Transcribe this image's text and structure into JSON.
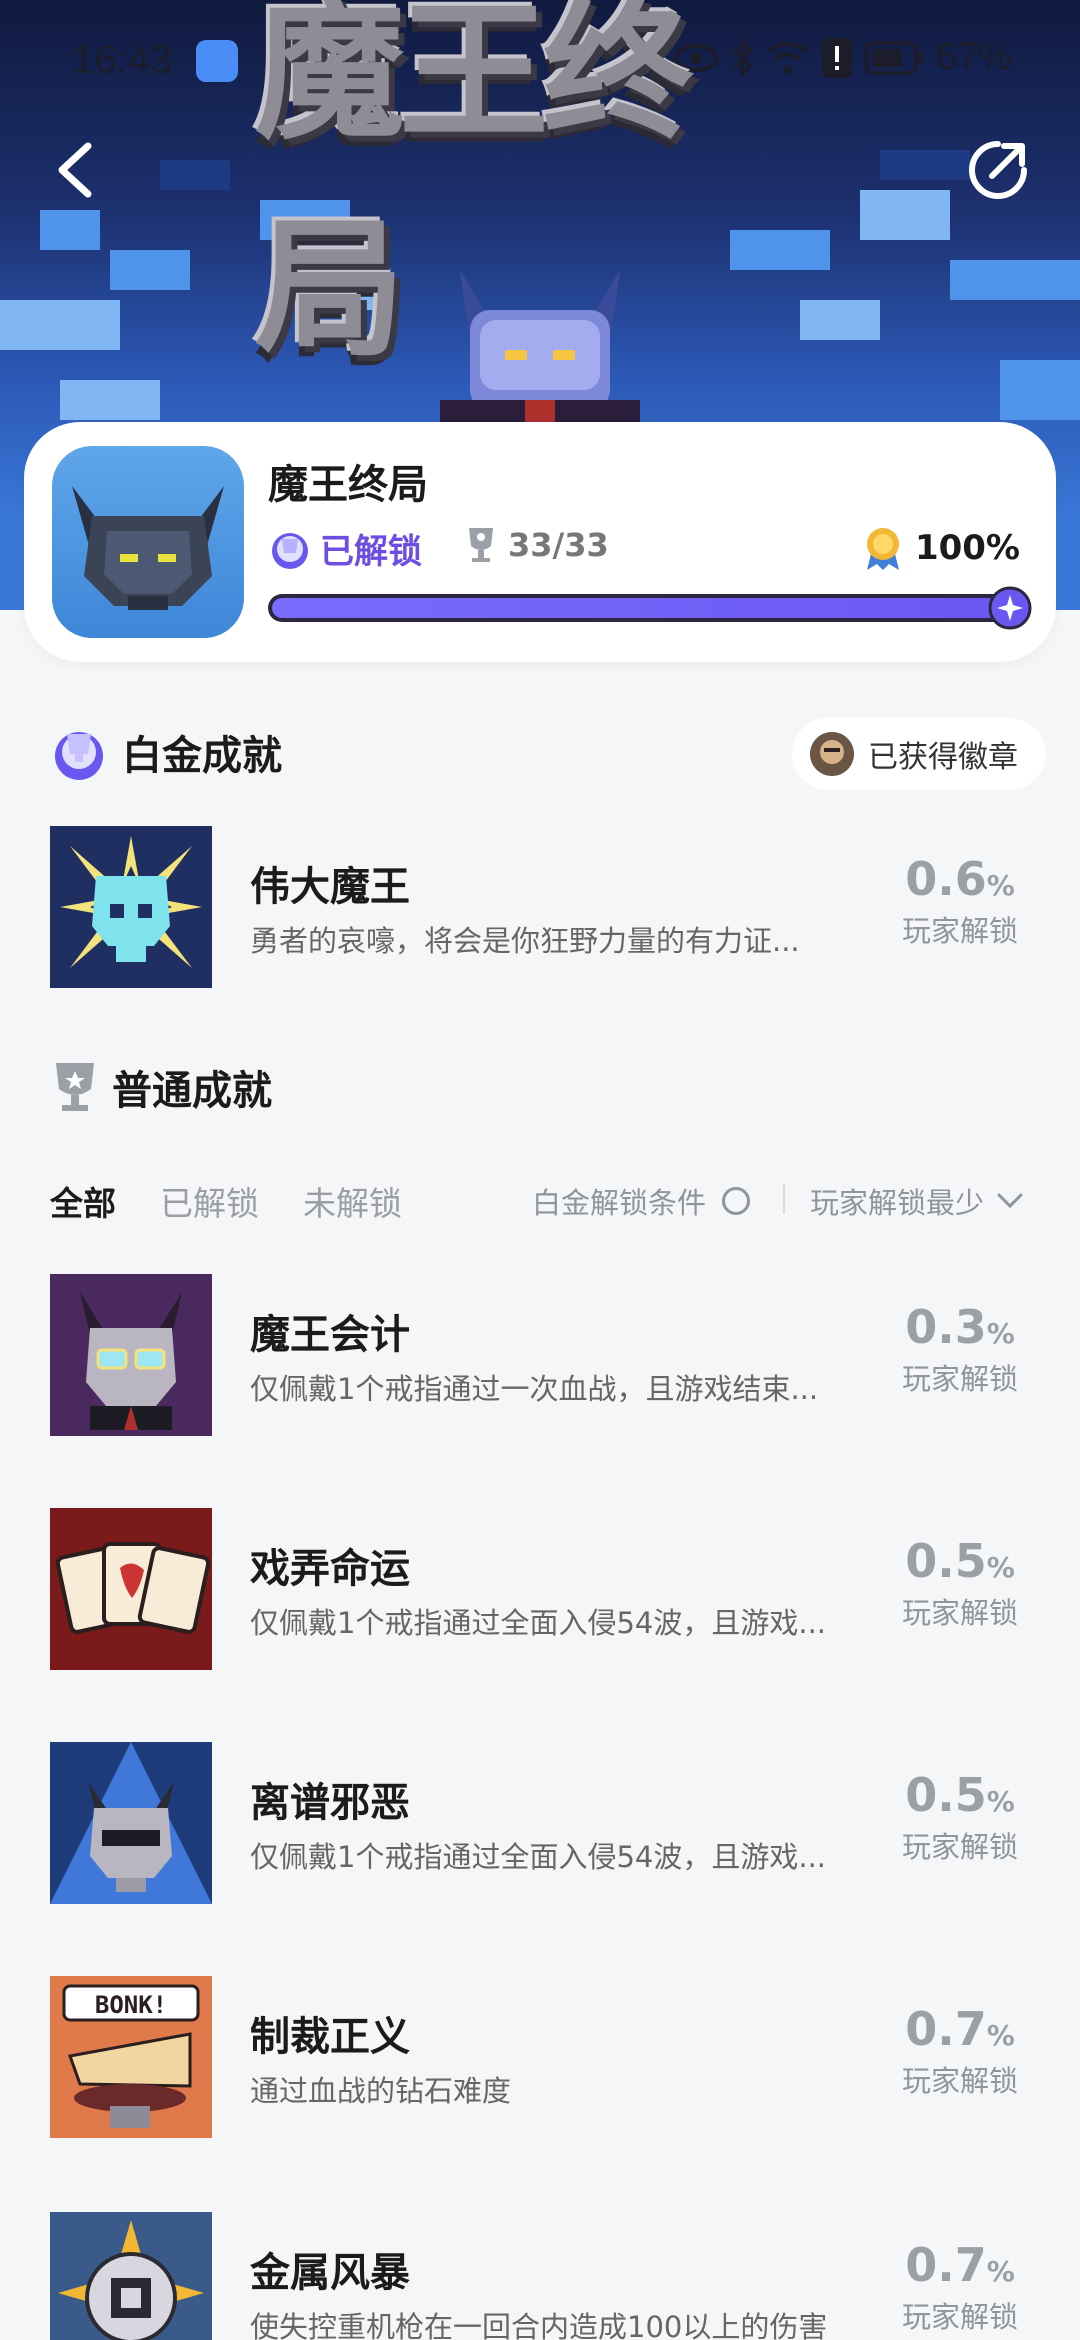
{
  "status_bar": {
    "time": "16:43",
    "battery": "67%"
  },
  "banner": {
    "logo_text": "魔王终局"
  },
  "game": {
    "name": "魔王终局",
    "unlock_label": "已解锁",
    "trophies": "33/33",
    "completion": "100%",
    "progress": 1.0
  },
  "platinum": {
    "section_title": "白金成就",
    "badge_label": "已获得徽章",
    "item": {
      "title": "伟大魔王",
      "desc": "勇者的哀嚎，将会是你狂野力量的有力证...",
      "rate": "0.6",
      "unit": "%",
      "rate_label": "玩家解锁"
    }
  },
  "normal": {
    "section_title": "普通成就",
    "tabs": [
      "全部",
      "已解锁",
      "未解锁"
    ],
    "condition_label": "白金解锁条件",
    "sort_label": "玩家解锁最少",
    "items": [
      {
        "title": "魔王会计",
        "desc": "仅佩戴1个戒指通过一次血战，且游戏结束...",
        "rate": "0.3",
        "unit": "%",
        "rate_label": "玩家解锁"
      },
      {
        "title": "戏弄命运",
        "desc": "仅佩戴1个戒指通过全面入侵54波，且游戏...",
        "rate": "0.5",
        "unit": "%",
        "rate_label": "玩家解锁"
      },
      {
        "title": "离谱邪恶",
        "desc": "仅佩戴1个戒指通过全面入侵54波，且游戏...",
        "rate": "0.5",
        "unit": "%",
        "rate_label": "玩家解锁"
      },
      {
        "title": "制裁正义",
        "desc": "通过血战的钻石难度",
        "rate": "0.7",
        "unit": "%",
        "rate_label": "玩家解锁"
      },
      {
        "title": "金属风暴",
        "desc": "使失控重机枪在一回合内造成100以上的伤害",
        "rate": "0.7",
        "unit": "%",
        "rate_label": "玩家解锁"
      }
    ]
  },
  "icon_text": {
    "bonk": "BONK!"
  },
  "colors": {
    "accent": "#6a57f0",
    "unlock_purple": "#6e4ee0"
  }
}
